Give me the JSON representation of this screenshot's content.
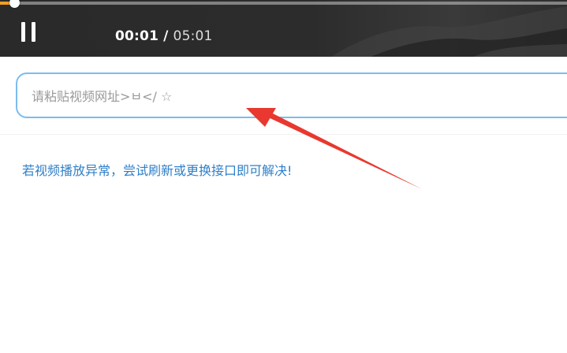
{
  "player": {
    "current_time": "00:01",
    "separator": "/",
    "duration": "05:01",
    "progress": 0.003,
    "pause_icon": "pause-icon"
  },
  "url_input": {
    "placeholder": "请粘贴视频网址>ㅂ</ ☆",
    "value": "",
    "border_color": "#7cbcef"
  },
  "tip": {
    "text": "若视频播放异常，尝试刷新或更换接口即可解决!",
    "color": "#2f7fc8"
  },
  "annotation": {
    "arrow_color": "#e8382f"
  }
}
